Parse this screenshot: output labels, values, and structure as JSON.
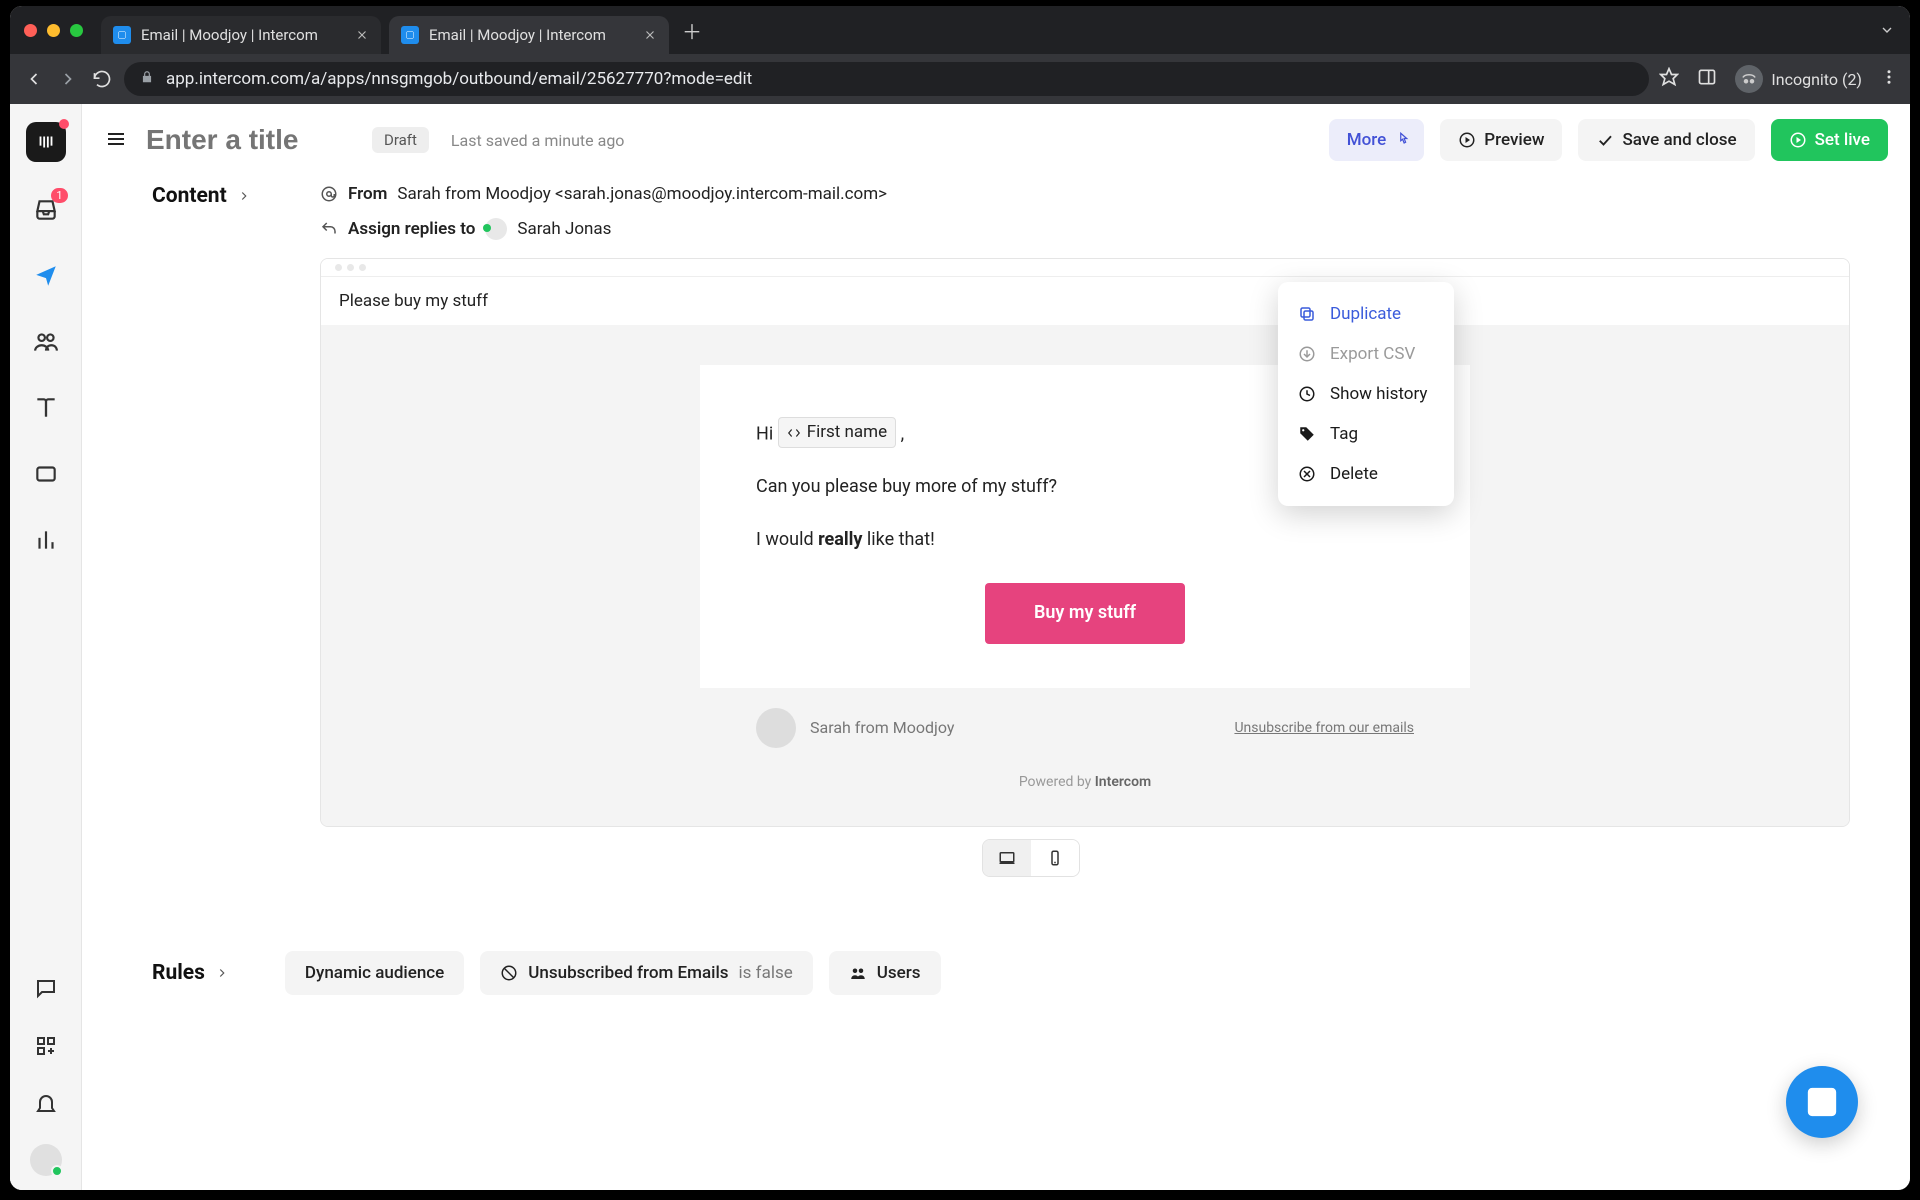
{
  "browser": {
    "tabs": [
      {
        "title": "Email | Moodjoy | Intercom",
        "active": false
      },
      {
        "title": "Email | Moodjoy | Intercom",
        "active": true
      }
    ],
    "url": "app.intercom.com/a/apps/nnsgmgob/outbound/email/25627770?mode=edit",
    "incognito_label": "Incognito (2)"
  },
  "sidebar": {
    "inbox_badge": "1"
  },
  "topbar": {
    "title_placeholder": "Enter a title",
    "draft_label": "Draft",
    "saved_label": "Last saved a minute ago",
    "more_label": "More",
    "preview_label": "Preview",
    "save_close_label": "Save and close",
    "set_live_label": "Set live"
  },
  "dropdown": {
    "items": [
      {
        "label": "Duplicate",
        "icon": "duplicate"
      },
      {
        "label": "Export CSV",
        "icon": "download"
      },
      {
        "label": "Show history",
        "icon": "clock"
      },
      {
        "label": "Tag",
        "icon": "tag"
      },
      {
        "label": "Delete",
        "icon": "x"
      }
    ]
  },
  "content": {
    "heading": "Content",
    "from_label": "From",
    "from_value": "Sarah from Moodjoy <sarah.jonas@moodjoy.intercom-mail.com>",
    "assign_label": "Assign replies to",
    "assign_value": "Sarah Jonas",
    "subject": "Please buy my stuff",
    "body": {
      "hi": "Hi ",
      "var_label": "First name",
      "comma": " ,",
      "line1": "Can you please buy more of my stuff?",
      "line2a": "I would ",
      "line2b": "really",
      "line2c": " like that!",
      "cta": "Buy my stuff"
    },
    "footer_name": "Sarah from Moodjoy",
    "unsubscribe": "Unsubscribe from our emails",
    "powered_prefix": "Powered by ",
    "powered_brand": "Intercom"
  },
  "rules": {
    "heading": "Rules",
    "chips": {
      "dynamic": "Dynamic audience",
      "unsub_pre": "Unsubscribed from Emails",
      "unsub_val": " is false",
      "users": "Users"
    }
  }
}
